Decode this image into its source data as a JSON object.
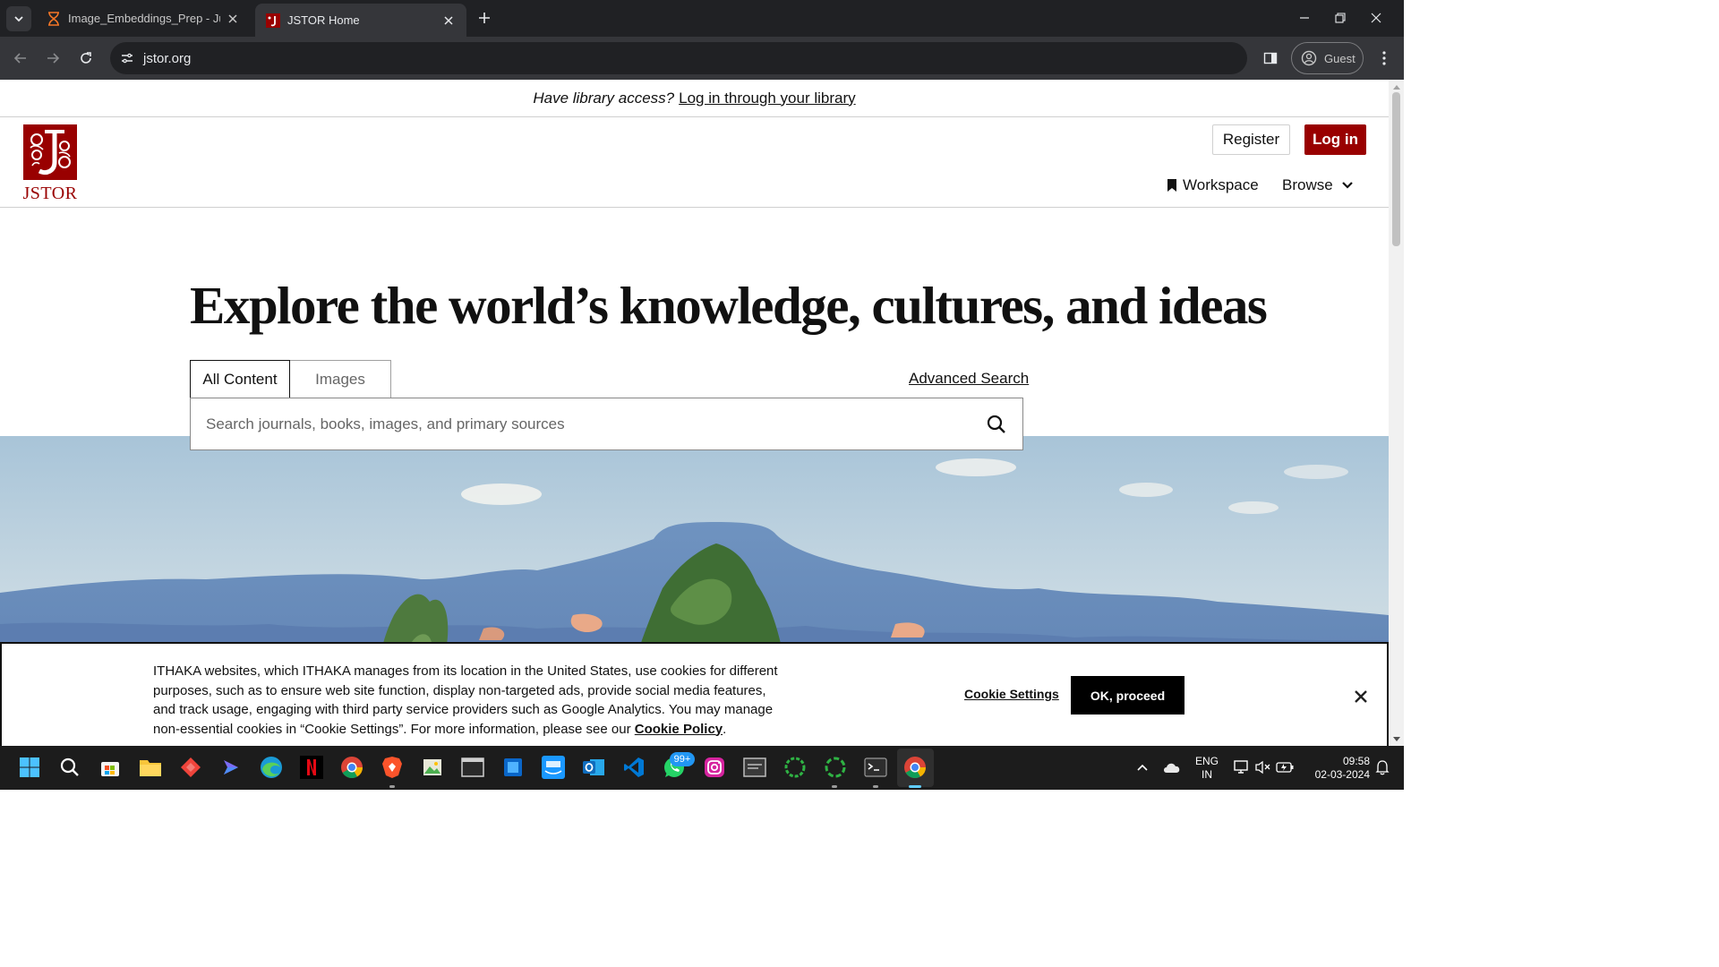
{
  "browser": {
    "tabs": [
      {
        "title": "Image_Embeddings_Prep - Jupyter",
        "icon": "hourglass-icon"
      },
      {
        "title": "JSTOR Home",
        "icon": "jstor-favicon"
      }
    ],
    "url": "jstor.org",
    "profile_label": "Guest"
  },
  "page": {
    "library_banner": {
      "question": "Have library access?",
      "link": "Log in through your library"
    },
    "header": {
      "logo_text": "JSTOR",
      "register_label": "Register",
      "login_label": "Log in",
      "workspace_label": "Workspace",
      "browse_label": "Browse"
    },
    "hero": {
      "title": "Explore the world’s knowledge, cultures, and ideas",
      "tabs": [
        "All Content",
        "Images"
      ],
      "active_tab": "All Content",
      "advanced_search_label": "Advanced Search",
      "search_placeholder": "Search journals, books, images, and primary sources"
    },
    "cookie_banner": {
      "text": "ITHAKA websites, which ITHAKA manages from its location in the United States, use cookies for different purposes, such as to ensure web site function, display non-targeted ads, provide social media features, and track usage, engaging with third party service providers such as Google Analytics. You may manage non-essential cookies in “Cookie Settings”. For more information, please see our",
      "policy_link": "Cookie Policy",
      "period": ".",
      "settings_label": "Cookie Settings",
      "proceed_label": "OK, proceed"
    }
  },
  "taskbar": {
    "whatsapp_badge": "99+",
    "language": [
      "ENG",
      "IN"
    ],
    "time": "09:58",
    "date": "02-03-2024"
  },
  "colors": {
    "jstor_red": "#990000",
    "chrome_dark": "#202124",
    "chrome_toolbar": "#35363a",
    "taskbar": "#1c1c1c"
  }
}
